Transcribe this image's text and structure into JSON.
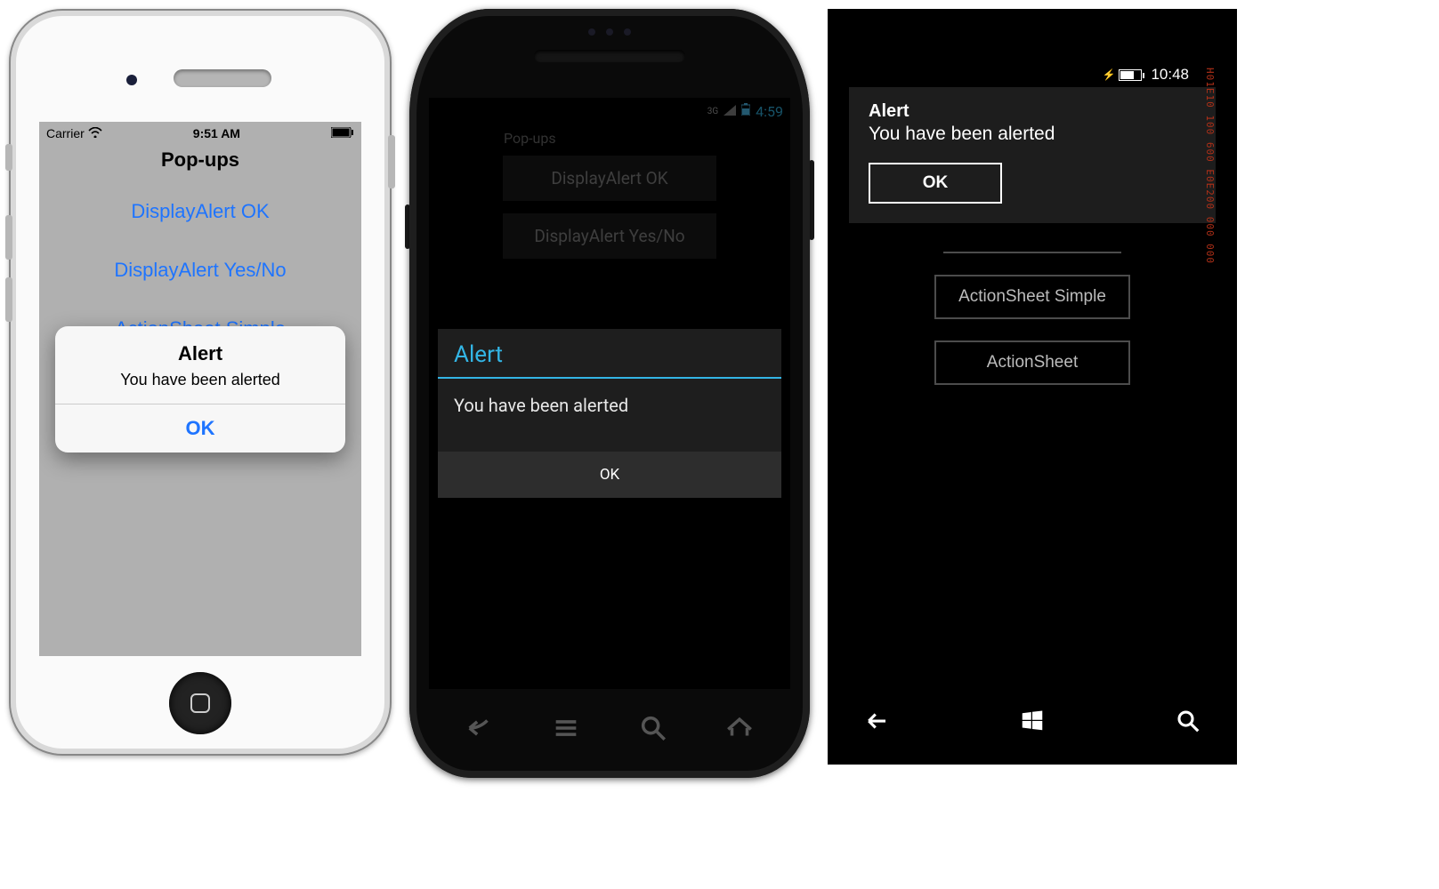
{
  "ios": {
    "status": {
      "carrier": "Carrier",
      "time": "9:51 AM"
    },
    "page_title": "Pop-ups",
    "buttons": {
      "display_ok": "DisplayAlert OK",
      "display_yesno": "DisplayAlert Yes/No",
      "actionsheet_simple": "ActionSheet Simple"
    },
    "alert": {
      "title": "Alert",
      "message": "You have been alerted",
      "ok": "OK"
    }
  },
  "android": {
    "status": {
      "net_label": "3G",
      "time": "4:59"
    },
    "page_title": "Pop-ups",
    "buttons": {
      "display_ok": "DisplayAlert OK",
      "display_yesno": "DisplayAlert Yes/No"
    },
    "alert": {
      "title": "Alert",
      "message": "You have been alerted",
      "ok": "OK"
    }
  },
  "wp": {
    "status": {
      "time": "10:48"
    },
    "alert": {
      "title": "Alert",
      "message": "You have been alerted",
      "ok": "OK"
    },
    "buttons": {
      "actionsheet_simple": "ActionSheet Simple",
      "actionsheet": "ActionSheet"
    },
    "debug_overlay": "H01E10 100 600 E0E200 000 000"
  }
}
